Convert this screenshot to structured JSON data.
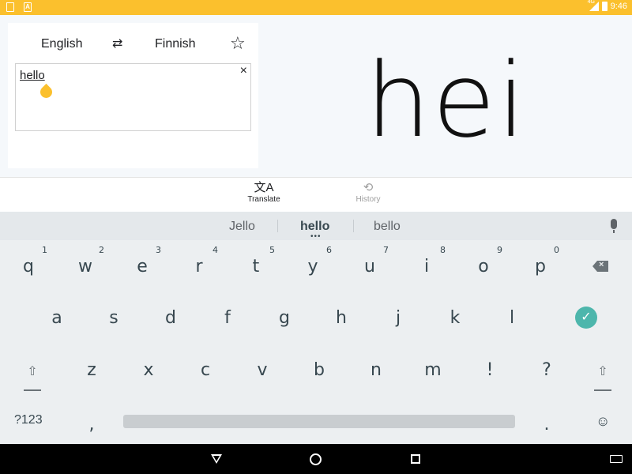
{
  "status_bar": {
    "time": "9:46",
    "network": "4G"
  },
  "translator": {
    "source_language": "English",
    "target_language": "Finnish",
    "input_text": "hello",
    "result_text": "hei",
    "swap_icon": "⇄",
    "star_icon": "☆",
    "clear_icon": "×"
  },
  "tabs": [
    {
      "label": "Translate",
      "icon": "文A"
    },
    {
      "label": "History",
      "icon": "⟲"
    }
  ],
  "keyboard": {
    "suggestions": [
      "Jello",
      "hello",
      "bello"
    ],
    "suggestion_dots": "•••",
    "row1": [
      {
        "k": "q",
        "h": "1"
      },
      {
        "k": "w",
        "h": "2"
      },
      {
        "k": "e",
        "h": "3"
      },
      {
        "k": "r",
        "h": "4"
      },
      {
        "k": "t",
        "h": "5"
      },
      {
        "k": "y",
        "h": "6"
      },
      {
        "k": "u",
        "h": "7"
      },
      {
        "k": "i",
        "h": "8"
      },
      {
        "k": "o",
        "h": "9"
      },
      {
        "k": "p",
        "h": "0"
      }
    ],
    "row2": [
      "a",
      "s",
      "d",
      "f",
      "g",
      "h",
      "j",
      "k",
      "l"
    ],
    "row3": [
      "z",
      "x",
      "c",
      "v",
      "b",
      "n",
      "m",
      "!",
      "?"
    ],
    "symbols_label": "?123",
    "comma": ",",
    "period": ".",
    "enter_icon": "✓",
    "shift_icon": "⇧",
    "emoji_icon": "☺",
    "backspace_icon": "×"
  }
}
